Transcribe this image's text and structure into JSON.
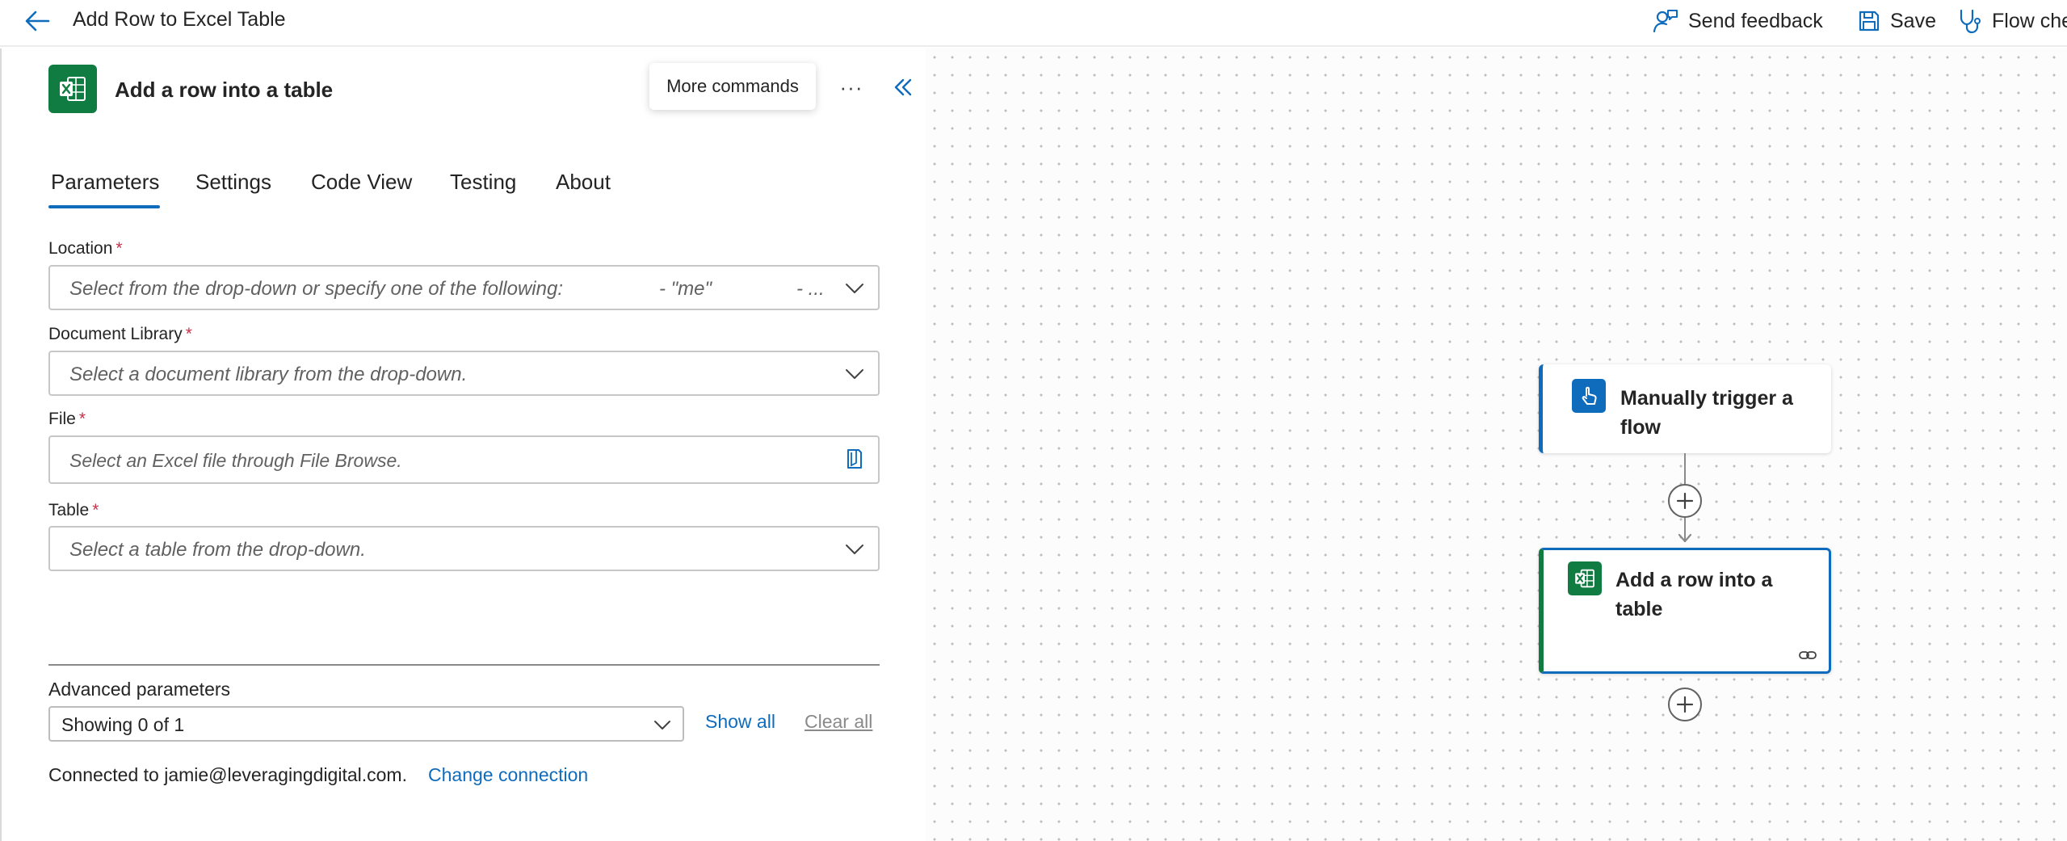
{
  "header": {
    "title": "Add Row to Excel Table",
    "send_feedback": "Send feedback",
    "save": "Save",
    "flow_checker": "Flow che"
  },
  "panel": {
    "action_title": "Add a row into a table",
    "tooltip": "More commands",
    "more_glyph": "···",
    "tabs": [
      {
        "label": "Parameters"
      },
      {
        "label": "Settings"
      },
      {
        "label": "Code View"
      },
      {
        "label": "Testing"
      },
      {
        "label": "About"
      }
    ],
    "fields": {
      "location": {
        "label": "Location",
        "required": "*",
        "placeholder": "Select from the drop-down or specify one of the following:",
        "opt1": "- \"me\"",
        "opt2": "- ..."
      },
      "library": {
        "label": "Document Library",
        "required": "*",
        "placeholder": "Select a document library from the drop-down."
      },
      "file": {
        "label": "File",
        "required": "*",
        "placeholder": "Select an Excel file through File Browse."
      },
      "table": {
        "label": "Table",
        "required": "*",
        "placeholder": "Select a table from the drop-down."
      }
    },
    "advanced": {
      "label": "Advanced parameters",
      "value": "Showing 0 of 1",
      "show_all": "Show all",
      "clear_all": "Clear all"
    },
    "connection": {
      "text": "Connected to jamie@leveragingdigital.com.",
      "change": "Change connection"
    }
  },
  "canvas": {
    "trigger_node": {
      "title": "Manually trigger a flow"
    },
    "action_node": {
      "title": "Add a row into a table"
    }
  },
  "colors": {
    "accent": "#0f6cbd",
    "excel_green": "#107c41",
    "required": "#c4314b"
  }
}
